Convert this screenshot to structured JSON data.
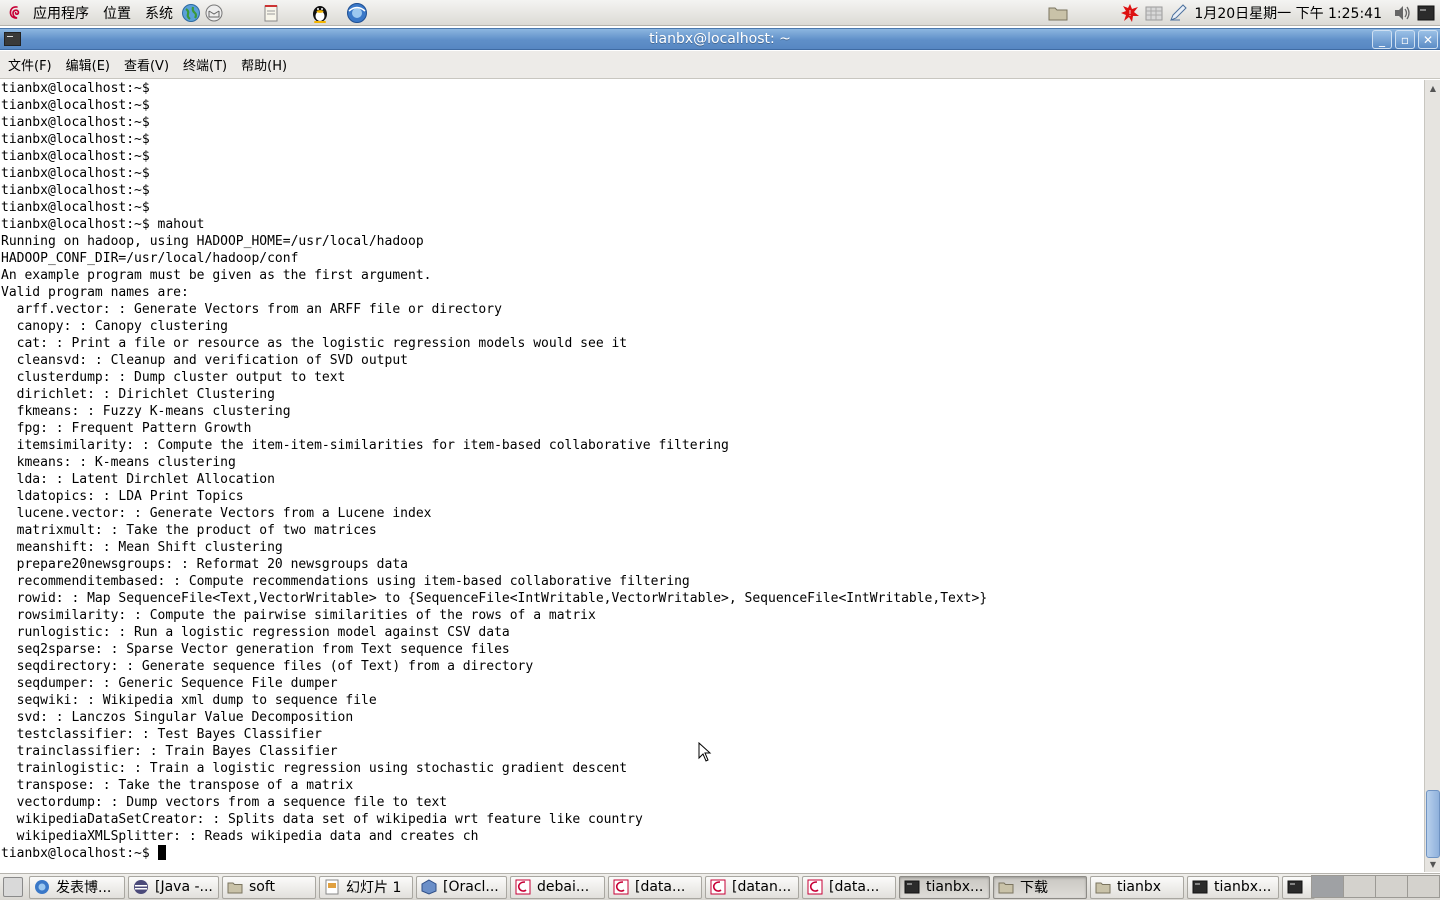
{
  "top_panel": {
    "menus": [
      "应用程序",
      "位置",
      "系统"
    ],
    "clock": "1月20日星期一 下午  1:25:41"
  },
  "window": {
    "title": "tianbx@localhost: ~"
  },
  "menubar": {
    "items": [
      "文件(F)",
      "编辑(E)",
      "查看(V)",
      "终端(T)",
      "帮助(H)"
    ]
  },
  "terminal": {
    "lines": [
      "tianbx@localhost:~$",
      "tianbx@localhost:~$",
      "tianbx@localhost:~$",
      "tianbx@localhost:~$",
      "tianbx@localhost:~$",
      "tianbx@localhost:~$",
      "tianbx@localhost:~$",
      "tianbx@localhost:~$",
      "tianbx@localhost:~$ mahout",
      "Running on hadoop, using HADOOP_HOME=/usr/local/hadoop",
      "HADOOP_CONF_DIR=/usr/local/hadoop/conf",
      "An example program must be given as the first argument.",
      "Valid program names are:",
      "  arff.vector: : Generate Vectors from an ARFF file or directory",
      "  canopy: : Canopy clustering",
      "  cat: : Print a file or resource as the logistic regression models would see it",
      "  cleansvd: : Cleanup and verification of SVD output",
      "  clusterdump: : Dump cluster output to text",
      "  dirichlet: : Dirichlet Clustering",
      "  fkmeans: : Fuzzy K-means clustering",
      "  fpg: : Frequent Pattern Growth",
      "  itemsimilarity: : Compute the item-item-similarities for item-based collaborative filtering",
      "  kmeans: : K-means clustering",
      "  lda: : Latent Dirchlet Allocation",
      "  ldatopics: : LDA Print Topics",
      "  lucene.vector: : Generate Vectors from a Lucene index",
      "  matrixmult: : Take the product of two matrices",
      "  meanshift: : Mean Shift clustering",
      "  prepare20newsgroups: : Reformat 20 newsgroups data",
      "  recommenditembased: : Compute recommendations using item-based collaborative filtering",
      "  rowid: : Map SequenceFile<Text,VectorWritable> to {SequenceFile<IntWritable,VectorWritable>, SequenceFile<IntWritable,Text>}",
      "  rowsimilarity: : Compute the pairwise similarities of the rows of a matrix",
      "  runlogistic: : Run a logistic regression model against CSV data",
      "  seq2sparse: : Sparse Vector generation from Text sequence files",
      "  seqdirectory: : Generate sequence files (of Text) from a directory",
      "  seqdumper: : Generic Sequence File dumper",
      "  seqwiki: : Wikipedia xml dump to sequence file",
      "  svd: : Lanczos Singular Value Decomposition",
      "  testclassifier: : Test Bayes Classifier",
      "  trainclassifier: : Train Bayes Classifier",
      "  trainlogistic: : Train a logistic regression using stochastic gradient descent",
      "  transpose: : Take the transpose of a matrix",
      "  vectordump: : Dump vectors from a sequence file to text",
      "  wikipediaDataSetCreator: : Splits data set of wikipedia wrt feature like country",
      "  wikipediaXMLSplitter: : Reads wikipedia data and creates ch"
    ],
    "prompt": "tianbx@localhost:~$ "
  },
  "taskbar": {
    "tasks": [
      {
        "label": "发表博...",
        "icon": "browser-icon",
        "width": 96
      },
      {
        "label": "[Java -...",
        "icon": "eclipse-icon",
        "width": 91
      },
      {
        "label": "soft",
        "icon": "folder-icon",
        "width": 94
      },
      {
        "label": "幻灯片 1",
        "icon": "presentation-icon",
        "width": 94
      },
      {
        "label": "[Oracl...",
        "icon": "virtualbox-icon",
        "width": 91
      },
      {
        "label": "debai...",
        "icon": "debian-icon",
        "width": 95
      },
      {
        "label": "[data...",
        "icon": "debian-icon",
        "width": 94
      },
      {
        "label": "[datan...",
        "icon": "debian-icon",
        "width": 94
      },
      {
        "label": "[data...",
        "icon": "debian-icon",
        "width": 94
      },
      {
        "label": "tianbx...",
        "icon": "terminal-icon",
        "width": 91,
        "active": true
      },
      {
        "label": "下载",
        "icon": "folder-icon",
        "width": 94,
        "active": true
      },
      {
        "label": "tianbx",
        "icon": "folder-icon",
        "width": 94
      },
      {
        "label": "tianbx...",
        "icon": "terminal-icon",
        "width": 92
      },
      {
        "label": "",
        "icon": "terminal-icon",
        "width": 33
      }
    ],
    "workspaces": 4
  },
  "colors": {
    "titlebar": "#5f8fc8",
    "panel": "#dcdad5",
    "terminal_bg": "#ffffff",
    "terminal_fg": "#000000"
  }
}
